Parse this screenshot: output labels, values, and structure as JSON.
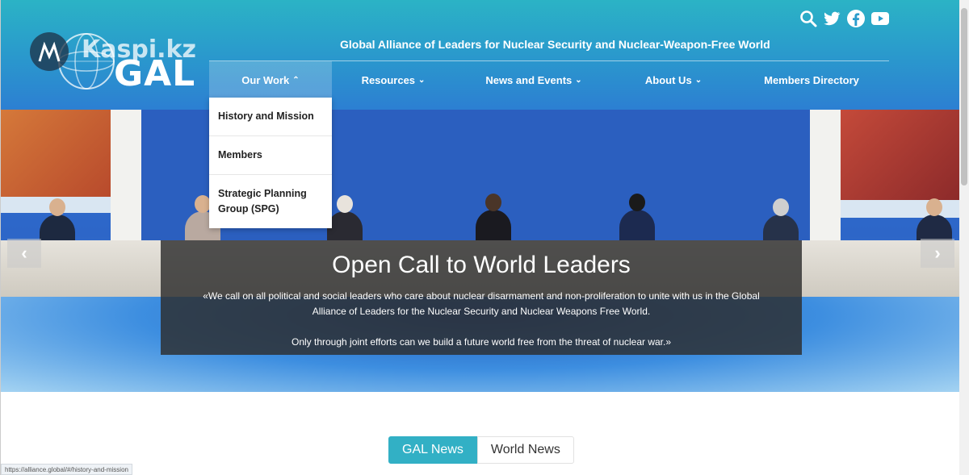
{
  "header": {
    "watermark": "Kaspi.kz",
    "logo_text": "GAL",
    "title": "Global Alliance of Leaders for Nuclear Security and Nuclear-Weapon-Free World",
    "icons": [
      "search-icon",
      "twitter-icon",
      "facebook-icon",
      "youtube-icon"
    ]
  },
  "nav": {
    "items": [
      {
        "label": "Our Work",
        "chevron": "up"
      },
      {
        "label": "Resources",
        "chevron": "down"
      },
      {
        "label": "News and Events",
        "chevron": "down"
      },
      {
        "label": "About Us",
        "chevron": "down"
      },
      {
        "label": "Members Directory"
      }
    ]
  },
  "dropdown": {
    "items": [
      "History and Mission",
      "Members",
      "Strategic Planning Group (SPG)"
    ]
  },
  "hero": {
    "title": "Open Call to World Leaders",
    "body": "«We call on all political and social leaders who care about nuclear disarmament and non-proliferation to unite with us in the Global Alliance of Leaders for the Nuclear Security and Nuclear Weapons Free World.",
    "body2": "Only through joint efforts can we build a future world free from the threat of nuclear war.»",
    "prev_icon": "chevron-left-icon",
    "next_icon": "chevron-right-icon"
  },
  "news_tabs": {
    "active": "GAL News",
    "inactive": "World News"
  },
  "status_bar": {
    "url": "https://alliance.global/#/history-and-mission"
  },
  "colors": {
    "header_top": "#2bb3c5",
    "header_bottom": "#2c7fd2",
    "accent": "#32b0c5"
  }
}
